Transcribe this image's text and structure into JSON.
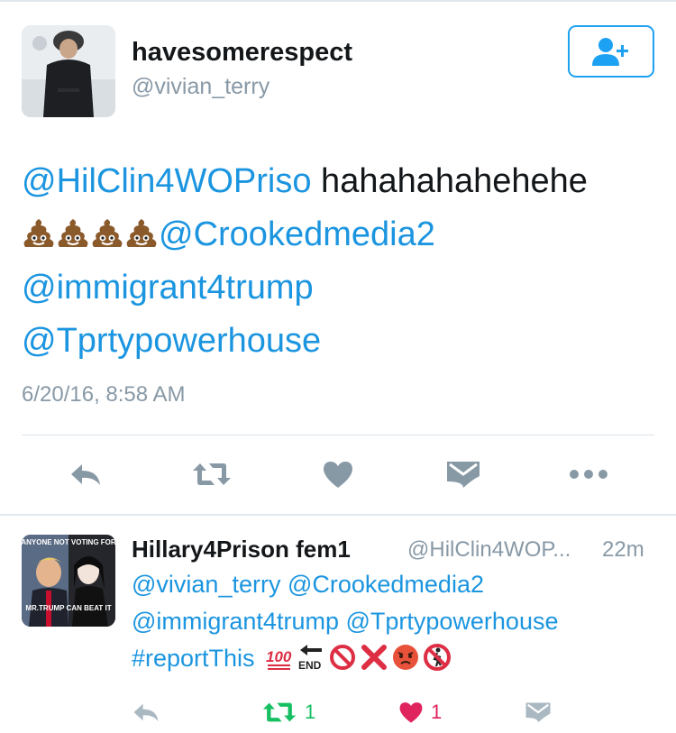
{
  "main_tweet": {
    "display_name": "havesomerespect",
    "handle": "@vivian_terry",
    "text": {
      "mention1": "@HilClin4WOPriso",
      "laugh": " hahahahahehehe",
      "mention2": "@Crookedmedia2",
      "mention3": "@immigrant4trump",
      "mention4": "@Tprtypowerhouse"
    },
    "emoji": [
      "pile-of-poo",
      "pile-of-poo",
      "pile-of-poo",
      "pile-of-poo"
    ],
    "timestamp": "6/20/16, 8:58 AM",
    "actions": [
      "reply-icon",
      "retweet-icon",
      "like-icon",
      "direct-message-icon",
      "more-icon"
    ]
  },
  "follow_button": {
    "icon": "add-user-icon"
  },
  "reply_tweet": {
    "display_name": "Hillary4Prison fem1",
    "handle": "@HilClin4WOP...",
    "time": "22m",
    "avatar_caption_top": "ANYONE NOT VOTING FOR",
    "avatar_caption_bottom": "MR.TRUMP CAN BEAT IT",
    "line1": "@vivian_terry @Crookedmedia2",
    "line2": "@immigrant4trump @Tprtypowerhouse",
    "line3": "#reportThis",
    "emoji": [
      "hundred-points",
      "end-arrow",
      "prohibited",
      "cross-mark",
      "pouting-face",
      "no-pedestrians"
    ],
    "retweet_count": "1",
    "like_count": "1"
  },
  "colors": {
    "link": "#1b95e0",
    "muted": "#8899a6",
    "retweet_active": "#17bf63",
    "like_active": "#e0245e"
  }
}
